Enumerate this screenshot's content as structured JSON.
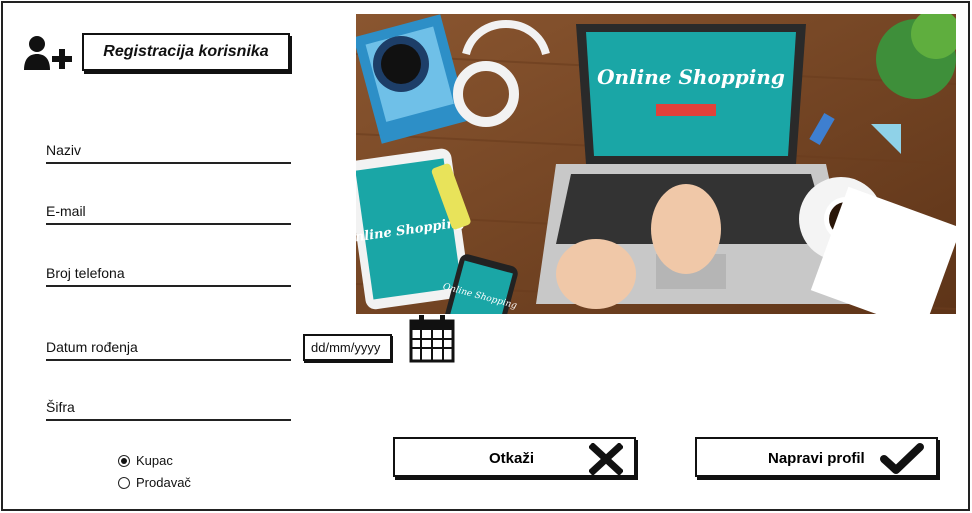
{
  "header": {
    "title": "Registracija korisnika",
    "icon": "add-user-icon"
  },
  "form": {
    "fields": [
      {
        "label": "Naziv"
      },
      {
        "label": "E-mail"
      },
      {
        "label": "Broj telefona"
      },
      {
        "label": "Datum rođenja"
      },
      {
        "label": "Šifra"
      }
    ],
    "date_placeholder": "dd/mm/yyyy",
    "date_icon": "calendar-icon",
    "role": {
      "options": [
        {
          "label": "Kupac",
          "selected": true
        },
        {
          "label": "Prodavač",
          "selected": false
        }
      ]
    }
  },
  "hero": {
    "laptop_screen_text": "Online Shopping",
    "tablet_screen_text": "Online Shopping",
    "phone_screen_text": "Online Shopping"
  },
  "actions": {
    "cancel_label": "Otkaži",
    "cancel_icon": "close-icon",
    "create_label": "Napravi profil",
    "create_icon": "checkmark-icon"
  },
  "colors": {
    "screen_teal": "#1aa6a6",
    "desk_wood": "#7a4a2a",
    "accent_red": "#e0413a"
  }
}
